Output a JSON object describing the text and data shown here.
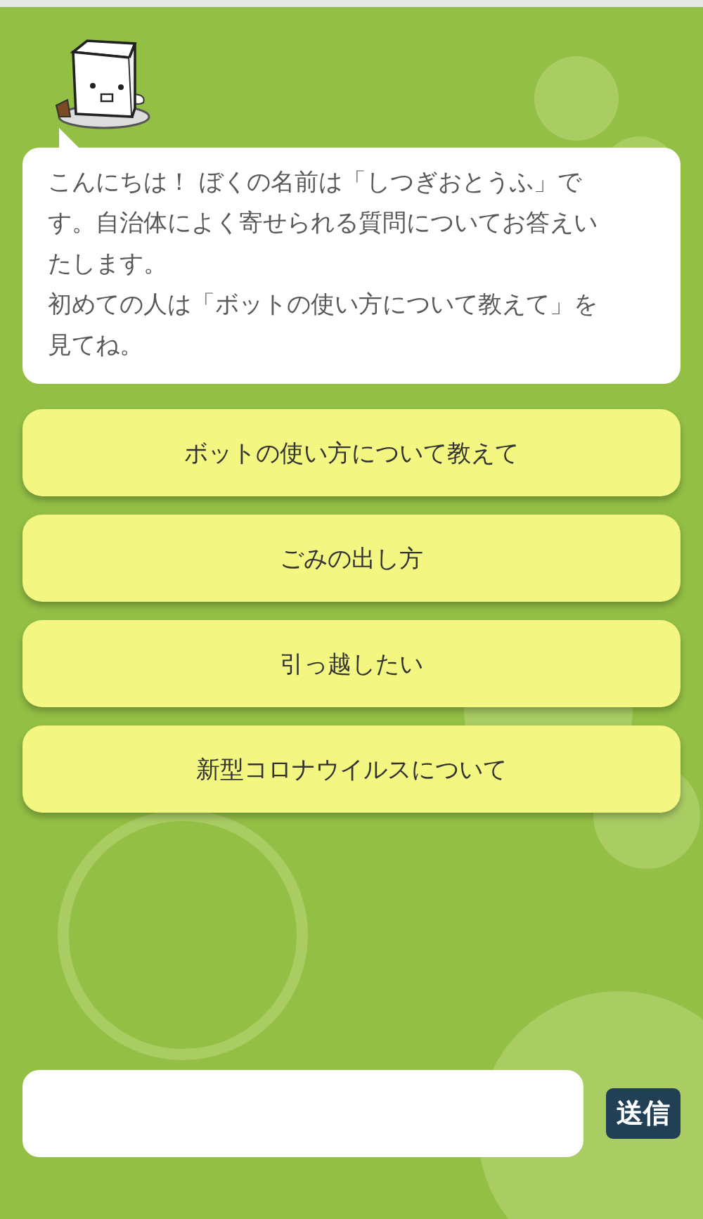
{
  "bot_message": {
    "lines": [
      "こんにちは！ ぼくの名前は「しつぎおとうふ」で",
      "す。自治体によく寄せられる質問についてお答えい",
      "たします。",
      "初めての人は「ボットの使い方について教えて」を",
      "見てね。"
    ]
  },
  "quick_replies": [
    {
      "label": "ボットの使い方について教えて"
    },
    {
      "label": "ごみの出し方"
    },
    {
      "label": "引っ越したい"
    },
    {
      "label": "新型コロナウイルスについて"
    }
  ],
  "composer": {
    "send_label": "送信"
  }
}
